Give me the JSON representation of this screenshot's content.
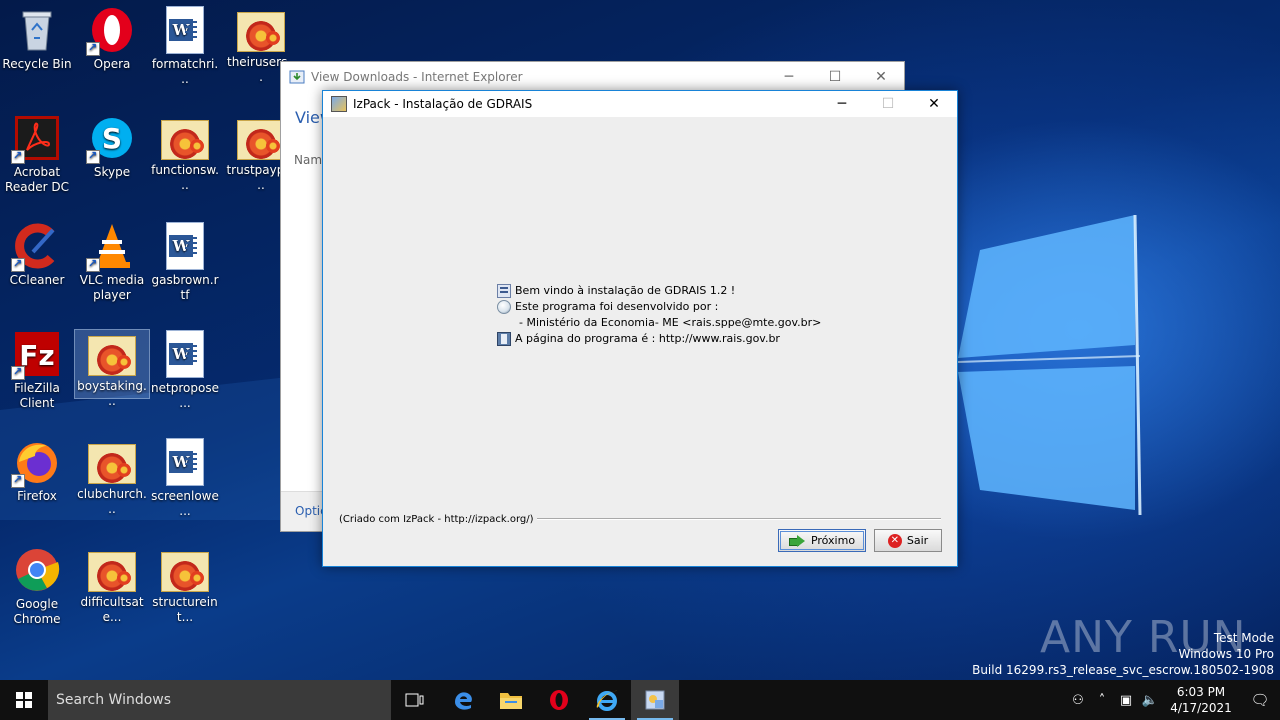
{
  "desktop_icons": [
    {
      "label": "Recycle Bin",
      "icon": "recycle-bin-icon"
    },
    {
      "label": "Opera",
      "icon": "opera-icon"
    },
    {
      "label": "formatchri...",
      "icon": "word-doc-icon"
    },
    {
      "label": "theirusers...",
      "icon": "image-file-icon"
    },
    {
      "label": "Acrobat Reader DC",
      "icon": "acrobat-icon"
    },
    {
      "label": "Skype",
      "icon": "skype-icon"
    },
    {
      "label": "functionsw...",
      "icon": "image-file-icon"
    },
    {
      "label": "trustpaypa...",
      "icon": "image-file-icon"
    },
    {
      "label": "CCleaner",
      "icon": "ccleaner-icon"
    },
    {
      "label": "VLC media player",
      "icon": "vlc-icon"
    },
    {
      "label": "gasbrown.rtf",
      "icon": "word-doc-icon"
    },
    {
      "label": "FileZilla Client",
      "icon": "filezilla-icon"
    },
    {
      "label": "boystaking...",
      "icon": "image-file-icon"
    },
    {
      "label": "netpropose...",
      "icon": "word-doc-icon"
    },
    {
      "label": "Firefox",
      "icon": "firefox-icon"
    },
    {
      "label": "clubchurch...",
      "icon": "image-file-icon"
    },
    {
      "label": "screenlowe...",
      "icon": "word-doc-icon"
    },
    {
      "label": "Google Chrome",
      "icon": "chrome-icon"
    },
    {
      "label": "difficultsate...",
      "icon": "image-file-icon"
    },
    {
      "label": "structureint...",
      "icon": "image-file-icon"
    }
  ],
  "ie_window": {
    "title": "View Downloads - Internet Explorer",
    "heading": "View",
    "column_name": "Nam",
    "options": "Optic"
  },
  "izpack": {
    "title": "IzPack - Instalação de GDRAIS",
    "lines": {
      "welcome": "Bem vindo à instalação de GDRAIS 1.2 !",
      "developed_by": "Este programa foi desenvolvido por :",
      "author": "- Ministério da Economia- ME <rais.sppe@mte.gov.br>",
      "homepage": "A página do programa é : http://www.rais.gov.br"
    },
    "credit": "(Criado com IzPack - http://izpack.org/)",
    "next_label": "Próximo",
    "exit_label": "Sair"
  },
  "watermark": {
    "brand": "ANY RUN",
    "mode": "Test Mode",
    "os": "Windows 10 Pro",
    "build": "Build 16299.rs3_release_svc_escrow.180502-1908"
  },
  "taskbar": {
    "search_placeholder": "Search Windows",
    "time": "6:03 PM",
    "date": "4/17/2021"
  },
  "colors": {
    "accent": "#1883d7",
    "taskbar": "#101010"
  }
}
